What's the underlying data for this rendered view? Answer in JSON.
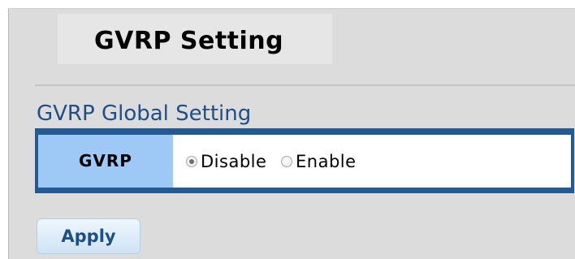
{
  "page": {
    "title": "GVRP Setting"
  },
  "section": {
    "title": "GVRP Global Setting"
  },
  "table": {
    "row_label": "GVRP",
    "options": [
      {
        "label": "Disable",
        "checked": true
      },
      {
        "label": "Enable",
        "checked": false
      }
    ]
  },
  "buttons": {
    "apply_label": "Apply"
  },
  "colors": {
    "section_title": "#1f4e86",
    "table_border": "#245a93",
    "label_cell": "#9ec8f5",
    "button_text": "#1f4e86"
  }
}
